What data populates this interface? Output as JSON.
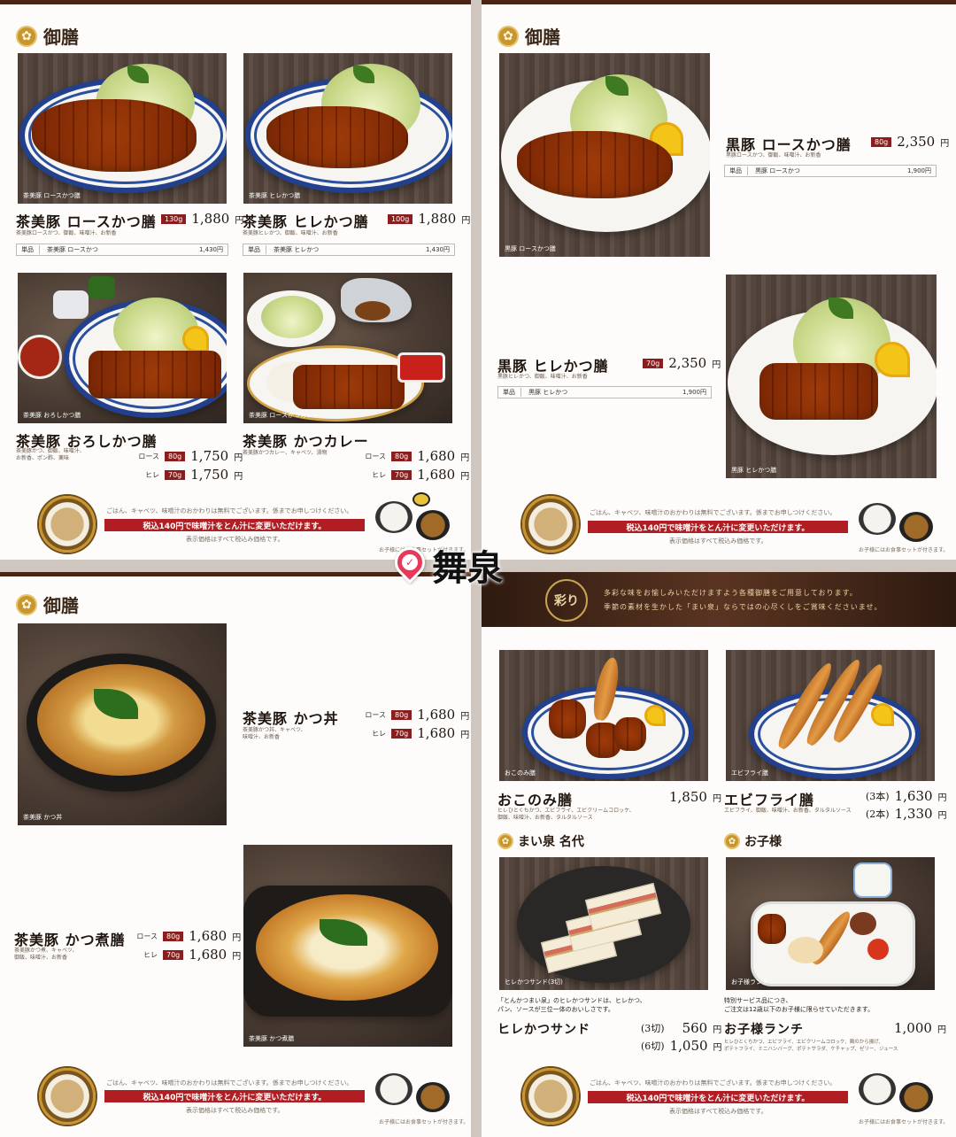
{
  "watermark": "舞泉",
  "banner": {
    "free_note": "ごはん、キャベツ、味噌汁のおかわりは無料でございます。係までお申しつけください。",
    "upgrade": "税込140円で味噌汁をとん汁に変更いただけます。",
    "tax_note": "表示価格はすべて税込み価格です。",
    "kids_note": "お子様にはお食事セットが付きます。"
  },
  "p1": {
    "section": "御膳",
    "i1": {
      "name": "茶美豚 ロースかつ膳",
      "weight": "130g",
      "price": "1,880",
      "yen": "円",
      "desc": "茶美豚ロースかつ、御飯、味噌汁、お新香",
      "cap": "茶美豚 ロースかつ膳",
      "single_tag": "単品",
      "single_name": "茶美豚 ロースかつ",
      "single_price": "1,430円"
    },
    "i2": {
      "name": "茶美豚 ヒレかつ膳",
      "weight": "100g",
      "price": "1,880",
      "yen": "円",
      "desc": "茶美豚ヒレかつ、御飯、味噌汁、お新香",
      "cap": "茶美豚 ヒレかつ膳",
      "single_tag": "単品",
      "single_name": "茶美豚 ヒレかつ",
      "single_price": "1,430円"
    },
    "i3": {
      "name": "茶美豚 おろしかつ膳",
      "desc1": "茶美豚かつ、御飯、味噌汁、",
      "desc2": "お新香、ポン酢、薬味",
      "cap": "茶美豚 おろしかつ膳",
      "l1": "ロース",
      "w1": "80g",
      "p1": "1,750",
      "l2": "ヒレ",
      "w2": "70g",
      "p2": "1,750",
      "yen": "円"
    },
    "i4": {
      "name": "茶美豚 かつカレー",
      "desc1": "茶美豚かつカレー、キャベツ、漬物",
      "cap": "茶美豚 ロースかつカレー",
      "l1": "ロース",
      "w1": "80g",
      "p1": "1,680",
      "l2": "ヒレ",
      "w2": "70g",
      "p2": "1,680",
      "yen": "円"
    }
  },
  "p2": {
    "section": "御膳",
    "i1": {
      "name": "黒豚 ロースかつ膳",
      "weight": "80g",
      "price": "2,350",
      "yen": "円",
      "desc": "黒豚ロースかつ、御飯、味噌汁、お新香",
      "cap": "黒豚 ロースかつ膳",
      "single_tag": "単品",
      "single_name": "黒豚 ロースかつ",
      "single_price": "1,900円"
    },
    "i2": {
      "name": "黒豚 ヒレかつ膳",
      "weight": "70g",
      "price": "2,350",
      "yen": "円",
      "desc": "黒豚ヒレかつ、御飯、味噌汁、お新香",
      "cap": "黒豚 ヒレかつ膳",
      "single_tag": "単品",
      "single_name": "黒豚 ヒレかつ",
      "single_price": "1,900円"
    }
  },
  "p3": {
    "section": "御膳",
    "i1": {
      "name": "茶美豚 かつ丼",
      "desc1": "茶美豚かつ丼、キャベツ、",
      "desc2": "味噌汁、お新香",
      "cap": "茶美豚 かつ丼",
      "l1": "ロース",
      "w1": "80g",
      "p1": "1,680",
      "l2": "ヒレ",
      "w2": "70g",
      "p2": "1,680",
      "yen": "円"
    },
    "i2": {
      "name": "茶美豚 かつ煮膳",
      "desc1": "茶美豚かつ煮、キャベツ、",
      "desc2": "御飯、味噌汁、お新香",
      "cap": "茶美豚 かつ煮膳",
      "l1": "ロース",
      "w1": "80g",
      "p1": "1,680",
      "l2": "ヒレ",
      "w2": "70g",
      "p2": "1,680",
      "yen": "円"
    }
  },
  "p4": {
    "emblem": "彩り",
    "intro1": "多彩な味をお愉しみいただけますよう各種御膳をご用意しております。",
    "intro2": "季節の素材を生かした「まい泉」ならではの心尽くしをご賞味くださいませ。",
    "i1": {
      "name": "おこのみ膳",
      "price": "1,850",
      "yen": "円",
      "desc1": "ヒレひとくちかつ、エビフライ、エビクリームコロッケ、",
      "desc2": "御飯、味噌汁、お新香、タルタルソース",
      "cap": "おこのみ膳"
    },
    "i2": {
      "name": "エビフライ膳",
      "c1": "(3本)",
      "p1": "1,630",
      "c2": "(2本)",
      "p2": "1,330",
      "yen": "円",
      "desc": "エビフライ、御飯、味噌汁、お新香、タルタルソース",
      "cap": "エビフライ膳"
    },
    "sub1": "まい泉 名代",
    "sub2": "お子様",
    "i3": {
      "name": "ヒレかつサンド",
      "intro1": "「とんかつまい泉」のヒレかつサンドは、ヒレかつ、",
      "intro2": "パン、ソースが三位一体のおいしさです。",
      "c1": "(3切)",
      "p1": "560",
      "c2": "(6切)",
      "p2": "1,050",
      "yen": "円",
      "cap": "ヒレかつサンド(3切)"
    },
    "i4": {
      "name": "お子様ランチ",
      "intro1": "特別サービス品につき、",
      "intro2": "ご注文は12歳以下のお子様に限らせていただきます。",
      "price": "1,000",
      "yen": "円",
      "desc1": "ヒレひとくちかつ、エビフライ、エビクリームコロッケ、鶏のから揚げ、",
      "desc2": "ポテトフライ、ミニハンバーグ、ポテトサラダ、ケチャップ、ゼリー、ジュース",
      "cap": "お子様ランチ"
    }
  }
}
